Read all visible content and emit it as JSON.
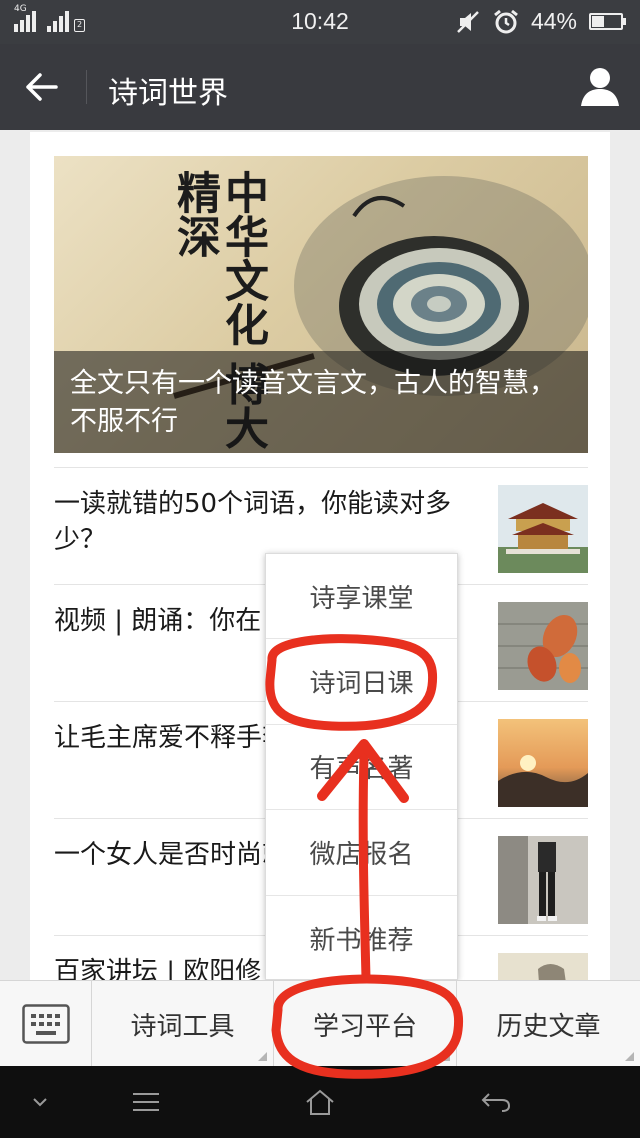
{
  "status_bar": {
    "network_label": "4G",
    "sim_label": "2",
    "time": "10:42",
    "battery_percent": "44%",
    "battery_level": 0.44,
    "icons": [
      "signal-icon",
      "mute-icon",
      "alarm-icon",
      "battery-icon"
    ]
  },
  "app_bar": {
    "title": "诗词世界",
    "back_icon": "arrow-left-icon",
    "profile_icon": "person-icon"
  },
  "hero": {
    "caption": "全文只有一个读音文言文，古人的智慧，不服不行",
    "art_text": "中华文化 博大精深"
  },
  "articles": [
    {
      "title": "一读就错的50个词语，你能读对多少？",
      "thumb": "pavilion-thumb"
    },
    {
      "title": "视频 | 朗诵：你在                    心里",
      "thumb": "leaf-thumb"
    },
    {
      "title": "让毛主席爱不释手李贺的这些诗词",
      "thumb": "sunset-thumb"
    },
    {
      "title": "一个女人是否时尚就能知道",
      "thumb": "fashion-thumb"
    },
    {
      "title": "百家讲坛 | 欧阳修",
      "thumb": "statue-thumb"
    }
  ],
  "popup_menu": {
    "items": [
      "诗享课堂",
      "诗词日课",
      "有声名著",
      "微店报名",
      "新书推荐"
    ]
  },
  "bottom_menu": {
    "keyboard_icon": "keyboard-icon",
    "tabs": [
      "诗词工具",
      "学习平台",
      "历史文章"
    ]
  },
  "nav_bar": {
    "icons": [
      "chevron-down-icon",
      "menu-icon",
      "home-icon",
      "back-icon"
    ]
  },
  "colors": {
    "app_bar": "#393a3f",
    "annotation_red": "#e8301f"
  }
}
